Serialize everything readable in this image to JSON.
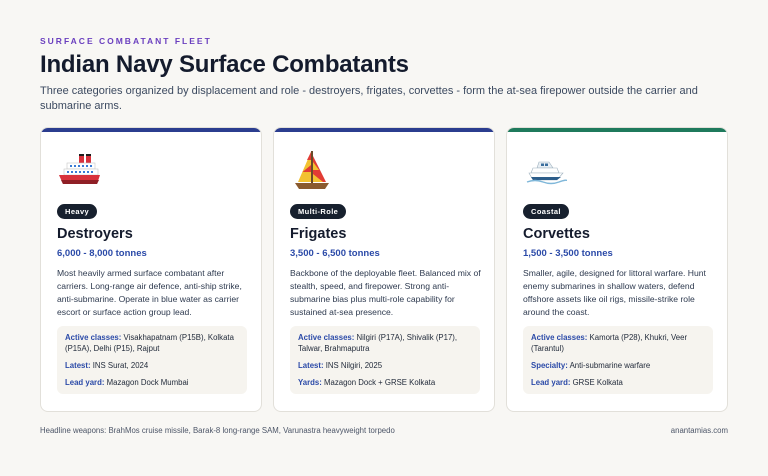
{
  "header": {
    "eyebrow": "SURFACE COMBATANT FLEET",
    "title": "Indian Navy Surface Combatants",
    "subtitle": "Three categories organized by displacement and role - destroyers, frigates, corvettes - form the at-sea firepower outside the carrier and submarine arms."
  },
  "cards": [
    {
      "accent_color": "#2b3d8f",
      "icon": "cruise-ship-icon",
      "badge": "Heavy",
      "name": "Destroyers",
      "tonnage": "6,000 - 8,000 tonnes",
      "description": "Most heavily armed surface combatant after carriers. Long-range air defence, anti-ship strike, anti-submarine. Operate in blue water as carrier escort or surface action group lead.",
      "details": [
        {
          "label": "Active classes:",
          "value": "Visakhapatnam (P15B), Kolkata (P15A), Delhi (P15), Rajput"
        },
        {
          "label": "Latest:",
          "value": "INS Surat, 2024"
        },
        {
          "label": "Lead yard:",
          "value": "Mazagon Dock Mumbai"
        }
      ]
    },
    {
      "accent_color": "#2b3d8f",
      "icon": "sailboat-icon",
      "badge": "Multi-Role",
      "name": "Frigates",
      "tonnage": "3,500 - 6,500 tonnes",
      "description": "Backbone of the deployable fleet. Balanced mix of stealth, speed, and firepower. Strong anti-submarine bias plus multi-role capability for sustained at-sea presence.",
      "details": [
        {
          "label": "Active classes:",
          "value": "Nilgiri (P17A), Shivalik (P17), Talwar, Brahmaputra"
        },
        {
          "label": "Latest:",
          "value": "INS Nilgiri, 2025"
        },
        {
          "label": "Yards:",
          "value": "Mazagon Dock + GRSE Kolkata"
        }
      ]
    },
    {
      "accent_color": "#1f7a5c",
      "icon": "speedboat-icon",
      "badge": "Coastal",
      "name": "Corvettes",
      "tonnage": "1,500 - 3,500 tonnes",
      "description": "Smaller, agile, designed for littoral warfare. Hunt enemy submarines in shallow waters, defend offshore assets like oil rigs, missile-strike role around the coast.",
      "details": [
        {
          "label": "Active classes:",
          "value": "Kamorta (P28), Khukri, Veer (Tarantul)"
        },
        {
          "label": "Specialty:",
          "value": "Anti-submarine warfare"
        },
        {
          "label": "Lead yard:",
          "value": "GRSE Kolkata"
        }
      ]
    }
  ],
  "footer": {
    "note": "Headline weapons: BrahMos cruise missile, Barak-8 long-range SAM, Varunastra heavyweight torpedo",
    "credit": "anantamias.com"
  }
}
